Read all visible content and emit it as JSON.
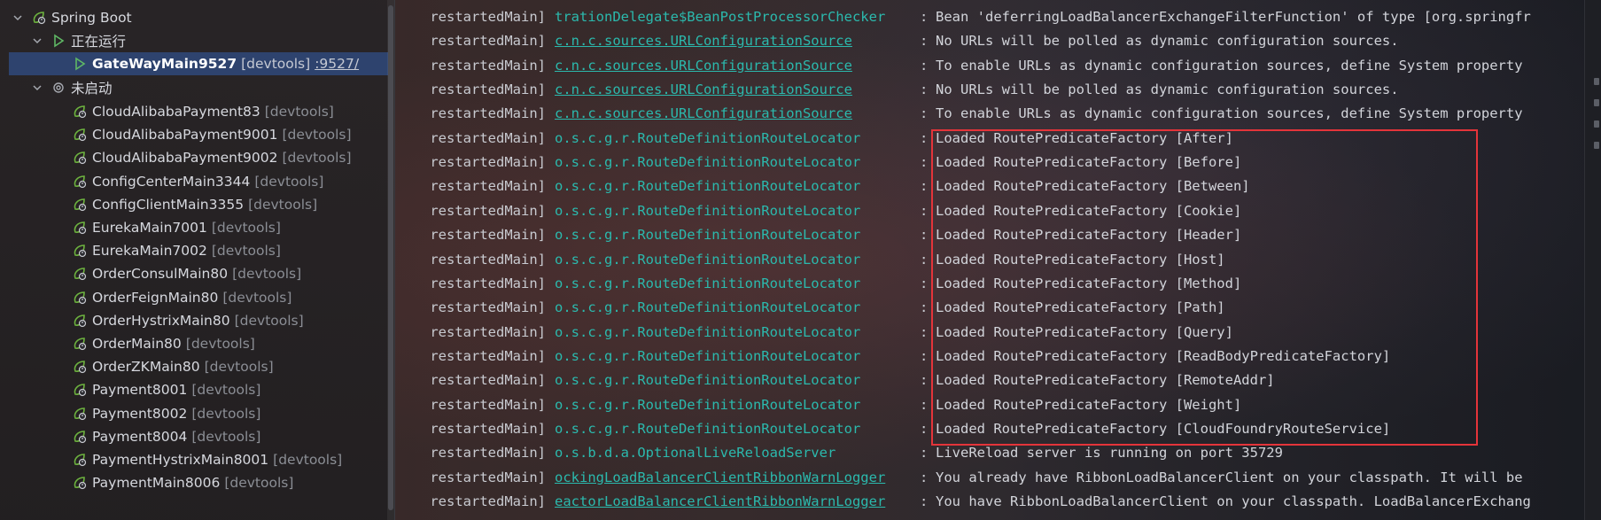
{
  "tree": {
    "root": {
      "label": "Spring Boot"
    },
    "running_group": {
      "label": "正在运行"
    },
    "running_items": [
      {
        "name": "GateWayMain9527",
        "tag": "[devtools]",
        "port": ":9527/"
      }
    ],
    "stopped_group": {
      "label": "未启动"
    },
    "stopped_items": [
      {
        "name": "CloudAlibabaPayment83",
        "tag": "[devtools]"
      },
      {
        "name": "CloudAlibabaPayment9001",
        "tag": "[devtools]"
      },
      {
        "name": "CloudAlibabaPayment9002",
        "tag": "[devtools]"
      },
      {
        "name": "ConfigCenterMain3344",
        "tag": "[devtools]"
      },
      {
        "name": "ConfigClientMain3355",
        "tag": "[devtools]"
      },
      {
        "name": "EurekaMain7001",
        "tag": "[devtools]"
      },
      {
        "name": "EurekaMain7002",
        "tag": "[devtools]"
      },
      {
        "name": "OrderConsulMain80",
        "tag": "[devtools]"
      },
      {
        "name": "OrderFeignMain80",
        "tag": "[devtools]"
      },
      {
        "name": "OrderHystrixMain80",
        "tag": "[devtools]"
      },
      {
        "name": "OrderMain80",
        "tag": "[devtools]"
      },
      {
        "name": "OrderZKMain80",
        "tag": "[devtools]"
      },
      {
        "name": "Payment8001",
        "tag": "[devtools]"
      },
      {
        "name": "Payment8002",
        "tag": "[devtools]"
      },
      {
        "name": "Payment8004",
        "tag": "[devtools]"
      },
      {
        "name": "PaymentHystrixMain8001",
        "tag": "[devtools]"
      },
      {
        "name": "PaymentMain8006",
        "tag": "[devtools]"
      }
    ]
  },
  "console": {
    "lines": [
      {
        "thread": "restartedMain]",
        "logger": "trationDelegate$BeanPostProcessorChecker",
        "sep": ":",
        "msg": "Bean 'deferringLoadBalancerExchangeFilterFunction' of type [org.springfr"
      },
      {
        "thread": "restartedMain]",
        "logger": "c.n.c.sources.URLConfigurationSource",
        "sep": ":",
        "msg": "No URLs will be polled as dynamic configuration sources."
      },
      {
        "thread": "restartedMain]",
        "logger": "c.n.c.sources.URLConfigurationSource",
        "sep": ":",
        "msg": "To enable URLs as dynamic configuration sources, define System property"
      },
      {
        "thread": "restartedMain]",
        "logger": "c.n.c.sources.URLConfigurationSource",
        "sep": ":",
        "msg": "No URLs will be polled as dynamic configuration sources."
      },
      {
        "thread": "restartedMain]",
        "logger": "c.n.c.sources.URLConfigurationSource",
        "sep": ":",
        "msg": "To enable URLs as dynamic configuration sources, define System property"
      },
      {
        "thread": "restartedMain]",
        "logger": "o.s.c.g.r.RouteDefinitionRouteLocator",
        "sep": ":",
        "msg": "Loaded RoutePredicateFactory [After]"
      },
      {
        "thread": "restartedMain]",
        "logger": "o.s.c.g.r.RouteDefinitionRouteLocator",
        "sep": ":",
        "msg": "Loaded RoutePredicateFactory [Before]"
      },
      {
        "thread": "restartedMain]",
        "logger": "o.s.c.g.r.RouteDefinitionRouteLocator",
        "sep": ":",
        "msg": "Loaded RoutePredicateFactory [Between]"
      },
      {
        "thread": "restartedMain]",
        "logger": "o.s.c.g.r.RouteDefinitionRouteLocator",
        "sep": ":",
        "msg": "Loaded RoutePredicateFactory [Cookie]"
      },
      {
        "thread": "restartedMain]",
        "logger": "o.s.c.g.r.RouteDefinitionRouteLocator",
        "sep": ":",
        "msg": "Loaded RoutePredicateFactory [Header]"
      },
      {
        "thread": "restartedMain]",
        "logger": "o.s.c.g.r.RouteDefinitionRouteLocator",
        "sep": ":",
        "msg": "Loaded RoutePredicateFactory [Host]"
      },
      {
        "thread": "restartedMain]",
        "logger": "o.s.c.g.r.RouteDefinitionRouteLocator",
        "sep": ":",
        "msg": "Loaded RoutePredicateFactory [Method]"
      },
      {
        "thread": "restartedMain]",
        "logger": "o.s.c.g.r.RouteDefinitionRouteLocator",
        "sep": ":",
        "msg": "Loaded RoutePredicateFactory [Path]"
      },
      {
        "thread": "restartedMain]",
        "logger": "o.s.c.g.r.RouteDefinitionRouteLocator",
        "sep": ":",
        "msg": "Loaded RoutePredicateFactory [Query]"
      },
      {
        "thread": "restartedMain]",
        "logger": "o.s.c.g.r.RouteDefinitionRouteLocator",
        "sep": ":",
        "msg": "Loaded RoutePredicateFactory [ReadBodyPredicateFactory]"
      },
      {
        "thread": "restartedMain]",
        "logger": "o.s.c.g.r.RouteDefinitionRouteLocator",
        "sep": ":",
        "msg": "Loaded RoutePredicateFactory [RemoteAddr]"
      },
      {
        "thread": "restartedMain]",
        "logger": "o.s.c.g.r.RouteDefinitionRouteLocator",
        "sep": ":",
        "msg": "Loaded RoutePredicateFactory [Weight]"
      },
      {
        "thread": "restartedMain]",
        "logger": "o.s.c.g.r.RouteDefinitionRouteLocator",
        "sep": ":",
        "msg": "Loaded RoutePredicateFactory [CloudFoundryRouteService]"
      },
      {
        "thread": "restartedMain]",
        "logger": "o.s.b.d.a.OptionalLiveReloadServer",
        "sep": ":",
        "msg": "LiveReload server is running on port 35729"
      },
      {
        "thread": "restartedMain]",
        "logger": "ockingLoadBalancerClientRibbonWarnLogger",
        "sep": ":",
        "msg": "You already have RibbonLoadBalancerClient on your classpath. It will be"
      },
      {
        "thread": "restartedMain]",
        "logger": "eactorLoadBalancerClientRibbonWarnLogger",
        "sep": ":",
        "msg": "You have RibbonLoadBalancerClient on your classpath. LoadBalancerExchang"
      }
    ],
    "link_lines": [
      1,
      2,
      3,
      4,
      19,
      20
    ]
  },
  "colors": {
    "logger": "#2bb9ad",
    "highlight": "#e4343a",
    "selection": "#2e436e",
    "run_icon": "#5fb865",
    "spring_icon": "#6db33f"
  }
}
